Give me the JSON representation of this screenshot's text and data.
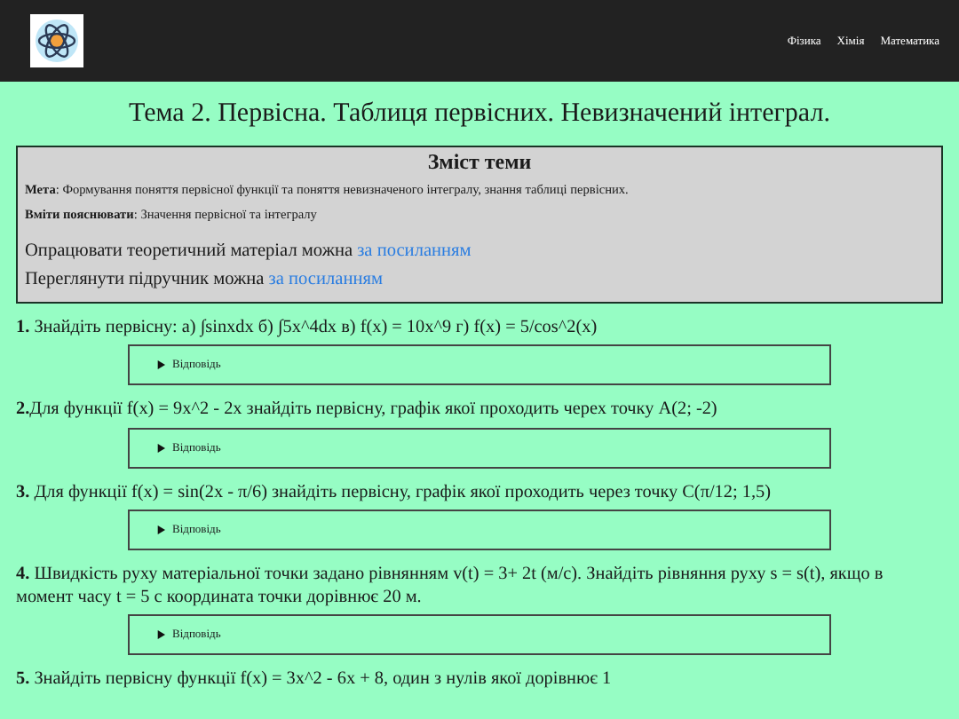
{
  "nav": [
    {
      "label": "Фізика"
    },
    {
      "label": "Хімія"
    },
    {
      "label": "Математика"
    }
  ],
  "title": "Тема 2. Первісна. Таблиця первісних. Невизначений інтеграл.",
  "summary": {
    "heading": "Зміст теми",
    "lines": [
      "**Мета**: Формування поняття первісної функції та поняття невизначеного інтегралу, знання таблиці первісних.",
      "**Вміти пояснювати**: Значення первісної та інтегралу"
    ],
    "links": [
      {
        "text": "Опрацювати теоретичний матеріал можна",
        "link": "за посиланням"
      },
      {
        "text": "Переглянути підручник можна",
        "link": "за посиланням"
      }
    ]
  },
  "tasks": [
    {
      "text": "**1.** Знайдіть первісну: а) ∫sinxdx б) ∫5x^4dx в) f(x) = 10x^9 г) f(x) = 5/cos^2(x)",
      "answer": {
        "label": "Відповідь",
        "expanded": false
      }
    },
    {
      "text": "**2.**Для функції f(x) = 9x^2 - 2x знайдіть первісну, графік якої проходить черех точку A(2; -2)",
      "answer": {
        "label": "Відповідь",
        "expanded": false
      }
    },
    {
      "text": "**3.** Для функції f(x) = sin(2x - π/6) знайдіть первісну, графік якої проходить через точку C(π/12; 1,5)",
      "answer": {
        "label": "Відповідь",
        "expanded": false
      }
    },
    {
      "text": "**4.** Швидкість руху матеріальної точки задано рівнянням v(t) = 3+ 2t (м/с). Знайдіть рівняння руху s = s(t), якщо в момент часу t = 5 с координата точки дорівнює 20 м.",
      "answer": {
        "label": "Відповідь",
        "expanded": false
      }
    },
    {
      "text": "**5.** Знайдіть первісну функції f(x) = 3x^2 - 6x + 8, один з нулів якої дорівнює 1"
    }
  ]
}
